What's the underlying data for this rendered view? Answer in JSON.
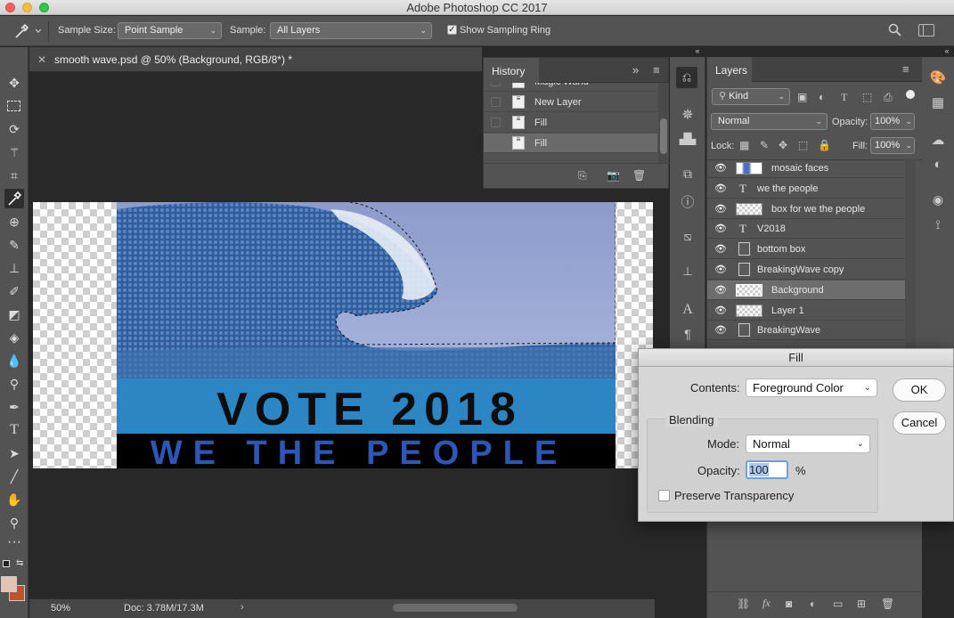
{
  "app": {
    "title": "Adobe Photoshop CC 2017"
  },
  "options_bar": {
    "sample_size_label": "Sample Size:",
    "sample_size_value": "Point Sample",
    "sample_label": "Sample:",
    "sample_value": "All Layers",
    "sampling_ring_label": "Show Sampling Ring",
    "sampling_ring_checked": true
  },
  "document": {
    "tab_title": "smooth wave.psd @ 50% (Background, RGB/8*)",
    "modified_mark": "*",
    "artwork": {
      "line1": "VOTE 2018",
      "line2": "WE THE PEOPLE"
    }
  },
  "status": {
    "zoom": "50%",
    "doc_size": "Doc: 3.78M/17.3M"
  },
  "history": {
    "title": "History",
    "items": [
      {
        "label": "Magic Wand",
        "icon": "magic-wand-icon",
        "selected": false
      },
      {
        "label": "New Layer",
        "icon": "document-icon",
        "selected": false
      },
      {
        "label": "Fill",
        "icon": "list-icon",
        "selected": false
      },
      {
        "label": "Fill",
        "icon": "list-icon",
        "selected": true
      }
    ]
  },
  "layers": {
    "title": "Layers",
    "filter_label": "Kind",
    "blend_mode": "Normal",
    "opacity_label": "Opacity:",
    "opacity_value": "100%",
    "lock_label": "Lock:",
    "fill_label": "Fill:",
    "fill_value": "100%",
    "items": [
      {
        "name": "mosaic faces",
        "type": "image",
        "selected": false
      },
      {
        "name": "we the people",
        "type": "text",
        "selected": false
      },
      {
        "name": "box for we the people",
        "type": "image",
        "selected": false
      },
      {
        "name": "V2018",
        "type": "text",
        "selected": false
      },
      {
        "name": "bottom box",
        "type": "smart",
        "selected": false
      },
      {
        "name": "BreakingWave copy",
        "type": "smart",
        "selected": false
      },
      {
        "name": "Background",
        "type": "image",
        "selected": true
      },
      {
        "name": "Layer 1",
        "type": "image",
        "selected": false
      },
      {
        "name": "BreakingWave",
        "type": "smart",
        "selected": false
      }
    ]
  },
  "fill_dialog": {
    "title": "Fill",
    "contents_label": "Contents:",
    "contents_value": "Foreground Color",
    "ok_label": "OK",
    "cancel_label": "Cancel",
    "blending_label": "Blending",
    "mode_label": "Mode:",
    "mode_value": "Normal",
    "opacity_label": "Opacity:",
    "opacity_value": "100",
    "opacity_unit": "%",
    "preserve_label": "Preserve Transparency",
    "preserve_checked": false
  },
  "colors": {
    "foreground": "#e3c4b2",
    "background": "#c0532e",
    "blue_band": "#2d86c4",
    "people_text": "#2c57b6"
  }
}
